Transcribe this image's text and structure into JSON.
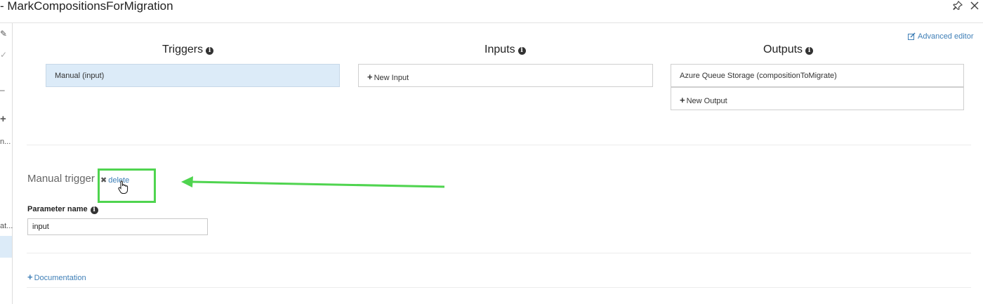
{
  "window": {
    "title": "- MarkCompositionsForMigration",
    "pin_icon": "pin-icon",
    "close_icon": "close-icon"
  },
  "leftbar": {
    "items": [
      "✎",
      "✓",
      "–",
      "+",
      "n...",
      "at..."
    ]
  },
  "toolbar": {
    "advanced_editor": "Advanced editor"
  },
  "columns": {
    "triggers": {
      "title": "Triggers",
      "items": [
        "Manual (input)"
      ]
    },
    "inputs": {
      "title": "Inputs",
      "new_label": "New Input"
    },
    "outputs": {
      "title": "Outputs",
      "items": [
        "Azure Queue Storage (compositionToMigrate)"
      ],
      "new_label": "New Output"
    }
  },
  "detail": {
    "section_title": "Manual trigger",
    "delete_label": "delete",
    "parameter_label": "Parameter name",
    "parameter_value": "input",
    "documentation_label": "Documentation"
  },
  "colors": {
    "accent": "#3f7fb7",
    "selected_bg": "#dcebf8",
    "annotation": "#4fd44f"
  }
}
